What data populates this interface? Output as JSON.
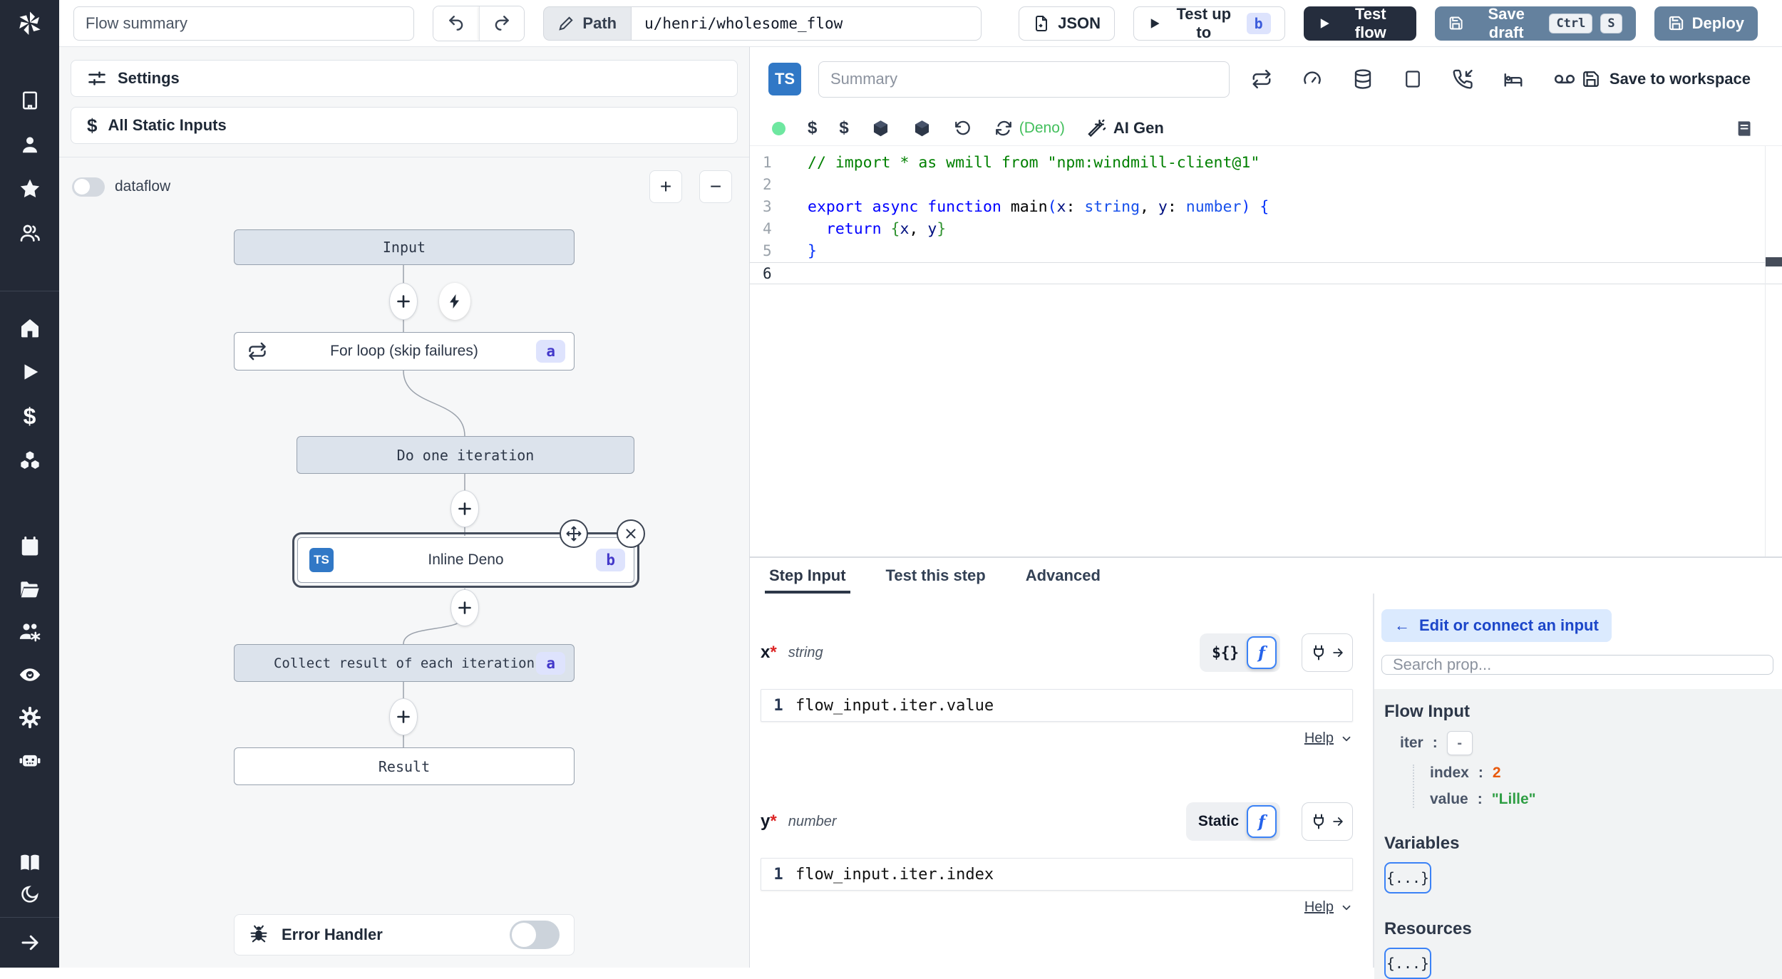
{
  "topbar": {
    "flow_summary_placeholder": "Flow summary",
    "path_label": "Path",
    "path_value": "u/henri/wholesome_flow",
    "json_button": "JSON",
    "test_up_to_label": "Test up to",
    "test_up_to_badge": "b",
    "test_flow_label": "Test flow",
    "save_draft_label": "Save draft",
    "save_draft_kbd": [
      "Ctrl",
      "S"
    ],
    "deploy_label": "Deploy"
  },
  "sidebar": {
    "icons": [
      "windmill-logo",
      "building",
      "user",
      "star",
      "users",
      "home",
      "play",
      "dollar",
      "boxes",
      "calendar",
      "folder-open",
      "users-settings",
      "eye",
      "settings-gear",
      "robot",
      "book-open",
      "moon",
      "arrow-right"
    ]
  },
  "flow_panel": {
    "settings_label": "Settings",
    "static_inputs_label": "All Static Inputs",
    "dataflow_label": "dataflow",
    "zoom_in": "+",
    "zoom_out": "−",
    "nodes": {
      "input": {
        "label": "Input"
      },
      "forloop": {
        "label": "For loop (skip failures)",
        "badge": "a"
      },
      "do_iteration": {
        "label": "Do one iteration"
      },
      "inline_deno": {
        "label": "Inline Deno",
        "badge": "b",
        "lang_badge": "TS"
      },
      "collect": {
        "label": "Collect result of each iteration",
        "badge": "a"
      },
      "result": {
        "label": "Result"
      }
    },
    "error_handler_label": "Error Handler"
  },
  "editor": {
    "lang_badge": "TS",
    "summary_placeholder": "Summary",
    "save_to_workspace_label": "Save to workspace",
    "toolbar_icons": [
      "status-dot",
      "dollar-variable",
      "dollar-resource",
      "package-1",
      "package-2",
      "rotate-ccw",
      "reload-deno",
      "ai-gen"
    ],
    "header_icons": [
      "repeat-retries",
      "gauge",
      "database-cache",
      "square-mock",
      "phone-incoming-suspend",
      "bed-sleep",
      "voicemail"
    ],
    "deno_label": "(Deno)",
    "ai_gen_label": "AI Gen",
    "code": {
      "active_line": 6,
      "lines": [
        [
          [
            "comment",
            "// import * as wmill from \"npm:windmill-client@1\""
          ]
        ],
        [],
        [
          [
            "kw",
            "export async function"
          ],
          [
            "plain",
            " main"
          ],
          [
            "b1",
            "("
          ],
          [
            "param",
            "x"
          ],
          [
            "plain",
            ": "
          ],
          [
            "type",
            "string"
          ],
          [
            "plain",
            ", "
          ],
          [
            "param",
            "y"
          ],
          [
            "plain",
            ": "
          ],
          [
            "type",
            "number"
          ],
          [
            "b1",
            ")"
          ],
          [
            "plain",
            " "
          ],
          [
            "b1",
            "{"
          ]
        ],
        [
          [
            "plain",
            "  "
          ],
          [
            "kw",
            "return"
          ],
          [
            "plain",
            " "
          ],
          [
            "b2",
            "{"
          ],
          [
            "param",
            "x"
          ],
          [
            "plain",
            ", "
          ],
          [
            "param",
            "y"
          ],
          [
            "b2",
            "}"
          ]
        ],
        [
          [
            "b1",
            "}"
          ]
        ],
        []
      ]
    }
  },
  "step_panel": {
    "tabs": [
      "Step Input",
      "Test this step",
      "Advanced"
    ],
    "active_tab": "Step Input",
    "fields": [
      {
        "name": "x",
        "required": "*",
        "type": "string",
        "mode": "${}",
        "line_no": "1",
        "expr": "flow_input.iter.value",
        "help": "Help"
      },
      {
        "name": "y",
        "required": "*",
        "type": "number",
        "mode": "Static",
        "line_no": "1",
        "expr": "flow_input.iter.index",
        "help": "Help"
      }
    ]
  },
  "connect_panel": {
    "edit_connect_arrow": "←",
    "edit_connect_label": "Edit or connect an input",
    "search_placeholder": "Search prop...",
    "flow_input_title": "Flow Input",
    "tree": {
      "root_key": "iter",
      "root_colon": ":",
      "root_toggle": "-",
      "children": [
        {
          "key": "index",
          "colon": ":",
          "value": "2"
        },
        {
          "key": "value",
          "colon": ":",
          "value": "\"Lille\""
        }
      ]
    },
    "variables_title": "Variables",
    "variables_value": "{...}",
    "resources_title": "Resources",
    "resources_value": "{...}"
  },
  "colors": {
    "sidebar_bg": "#232936",
    "accent_blue": "#3b82f6",
    "steel_button": "#64819e",
    "dark_button": "#252d3d",
    "ts_badge": "#3178c6",
    "badge_indigo_bg": "#dee3fd",
    "badge_indigo_text": "#4338ca",
    "status_green": "#6ee7a0",
    "deno_green": "#42bf5c",
    "value_orange": "#e8590c",
    "value_green": "#2f9e44"
  }
}
